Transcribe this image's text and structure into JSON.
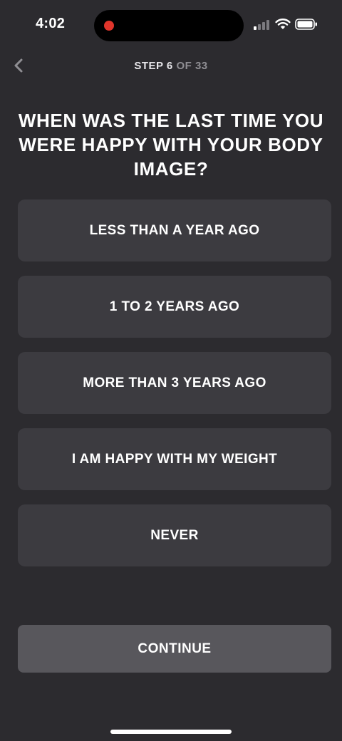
{
  "status_bar": {
    "time": "4:02"
  },
  "header": {
    "step_current": "STEP 6",
    "step_total": " OF 33"
  },
  "question": "WHEN WAS THE LAST TIME YOU WERE HAPPY WITH YOUR BODY IMAGE?",
  "options": [
    {
      "label": "LESS THAN A YEAR AGO"
    },
    {
      "label": "1 TO 2 YEARS AGO"
    },
    {
      "label": "MORE THAN 3 YEARS AGO"
    },
    {
      "label": "I AM HAPPY WITH MY WEIGHT"
    },
    {
      "label": "NEVER"
    }
  ],
  "continue_button": {
    "label": "CONTINUE"
  },
  "colors": {
    "background": "#2c2b2f",
    "option_background": "#3c3b40",
    "continue_background": "#58575c",
    "recording_dot": "#e0352b"
  },
  "icons": {
    "back": "chevron-left-icon",
    "signal": "cellular-signal-icon",
    "wifi": "wifi-icon",
    "battery": "battery-icon"
  }
}
